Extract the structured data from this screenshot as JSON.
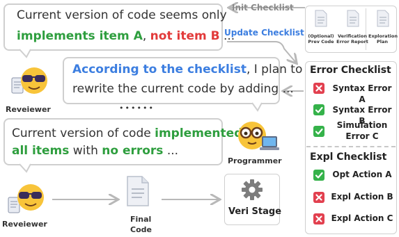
{
  "reviewer_bubble_1": {
    "line1": "Current version of code seems only",
    "implements": "implements item A",
    "comma": ",",
    "not_item": "not item B",
    "ellipsis": " ..."
  },
  "programmer_bubble": {
    "highlight": "According to the checklist",
    "line1_rest": ", I plan to",
    "line2": "rewrite the current code by adding ..."
  },
  "dots": "••••••",
  "reviewer_bubble_2": {
    "prefix": "Current version of code ",
    "implemented": "implemented",
    "all_items": "all items",
    "with": " with ",
    "no_errors": "no errors",
    "ellipsis": " ..."
  },
  "labels": {
    "reviewer_top": "Reveiewer",
    "reviewer_bottom": "Reveiewer",
    "programmer": "Programmer",
    "final_code_1": "Final",
    "final_code_2": "Code",
    "veri_stage": "Veri Stage"
  },
  "arrows": {
    "init_checklist": "Init Checklist",
    "update_checklist": "Update Checklist"
  },
  "docs": [
    {
      "line1": "(Optional)",
      "line2": "Prev Code"
    },
    {
      "line1": "Verification",
      "line2": "Error Report"
    },
    {
      "line1": "Exploration",
      "line2": "Plan"
    }
  ],
  "error_checklist": {
    "title": "Error Checklist",
    "items": [
      "Syntax Error A",
      "Syntax Error B",
      "Simulation Error C"
    ],
    "status": [
      "fail",
      "pass",
      "pass"
    ]
  },
  "expl_checklist": {
    "title": "Expl Checklist",
    "items": [
      "Opt Action A",
      "Expl Action B",
      "Expl Action C"
    ],
    "status": [
      "pass",
      "fail",
      "fail"
    ]
  },
  "colors": {
    "green": "#2e9e3e",
    "red": "#e23a3a",
    "blue": "#3c7ee0",
    "check_pass": "#35b24a",
    "check_fail": "#e2404f"
  }
}
